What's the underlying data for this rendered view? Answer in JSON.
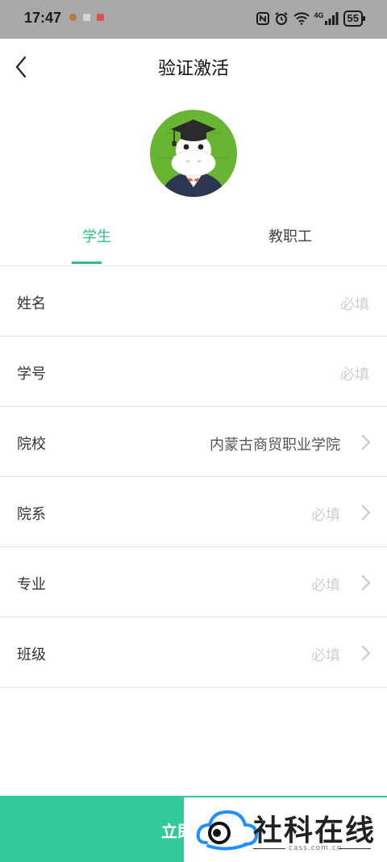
{
  "status_bar": {
    "time": "17:47",
    "network": "4G",
    "battery": "55",
    "icons": [
      "nfc-icon",
      "alarm-icon",
      "wifi-icon",
      "signal-icon"
    ]
  },
  "nav": {
    "title": "验证激活",
    "back_icon": "chevron-left-icon"
  },
  "tabs": [
    {
      "label": "学生",
      "active": true
    },
    {
      "label": "教职工",
      "active": false
    }
  ],
  "form": {
    "rows": [
      {
        "label": "姓名",
        "value": "必填",
        "chevron": false
      },
      {
        "label": "学号",
        "value": "必填",
        "chevron": false
      },
      {
        "label": "院校",
        "value": "内蒙古商贸职业学院",
        "chevron": true
      },
      {
        "label": "院系",
        "value": "必填",
        "chevron": true
      },
      {
        "label": "专业",
        "value": "必填",
        "chevron": true
      },
      {
        "label": "班级",
        "value": "必填",
        "chevron": true
      }
    ]
  },
  "submit": {
    "visible_label": "立即"
  },
  "watermark": {
    "name": "社科在线",
    "url": "cass.com.cn"
  },
  "colors": {
    "accent": "#2dbf8c",
    "button": "#34c998",
    "status_bar": "#a9a9a9"
  }
}
